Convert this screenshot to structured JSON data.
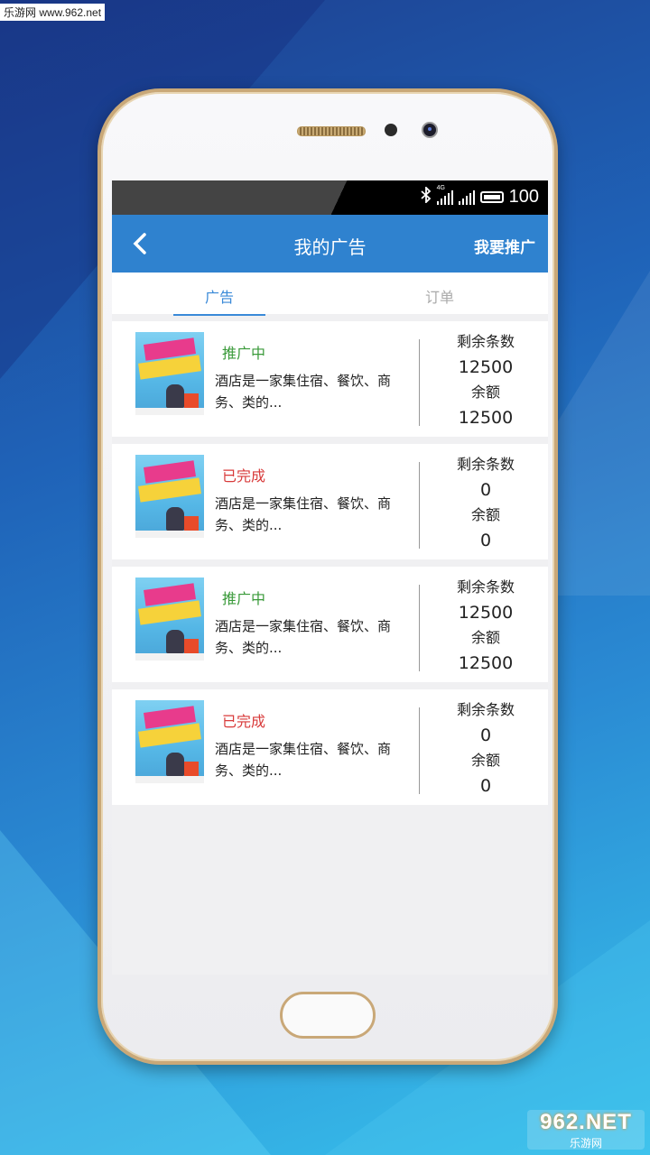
{
  "watermark": {
    "top": "乐游网 www.962.net",
    "logo": "962.NET",
    "sub": "乐游网"
  },
  "statusbar": {
    "network": "4G",
    "battery": "100"
  },
  "navbar": {
    "title": "我的广告",
    "action": "我要推广"
  },
  "tabs": [
    {
      "label": "广告",
      "active": true
    },
    {
      "label": "订单",
      "active": false
    }
  ],
  "ads": [
    {
      "status": "推广中",
      "status_color": "#3a9a3a",
      "desc": "酒店是一家集住宿、餐饮、商务、类的...",
      "remaining_label": "剩余条数",
      "remaining": "12500",
      "balance_label": "余额",
      "balance": "12500"
    },
    {
      "status": "已完成",
      "status_color": "#d83a3a",
      "desc": "酒店是一家集住宿、餐饮、商务、类的...",
      "remaining_label": "剩余条数",
      "remaining": "0",
      "balance_label": "余额",
      "balance": "0"
    },
    {
      "status": "推广中",
      "status_color": "#3a9a3a",
      "desc": "酒店是一家集住宿、餐饮、商务、类的...",
      "remaining_label": "剩余条数",
      "remaining": "12500",
      "balance_label": "余额",
      "balance": "12500"
    },
    {
      "status": "已完成",
      "status_color": "#d83a3a",
      "desc": "酒店是一家集住宿、餐饮、商务、类的...",
      "remaining_label": "剩余条数",
      "remaining": "0",
      "balance_label": "余额",
      "balance": "0"
    }
  ],
  "colors": {
    "primary": "#2f82cf",
    "tab_active": "#3a8ad8",
    "frame_gold": "#c9a878"
  }
}
